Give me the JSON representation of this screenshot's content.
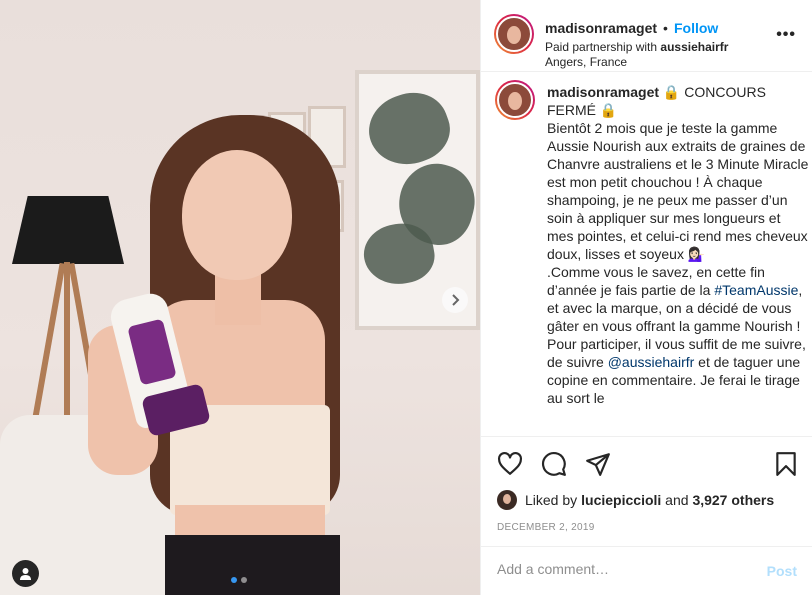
{
  "post": {
    "username": "madisonramaget",
    "dot": "•",
    "follow_label": "Follow",
    "partner_prefix": "Paid partnership with ",
    "partner": "aussiehairfr",
    "location": "Angers, France",
    "more_label": "•••"
  },
  "caption": {
    "username": "madisonramaget",
    "text_1": " 🔒 CONCOURS FERMÉ 🔒\nBientôt 2 mois que je teste la gamme Aussie Nourish aux extraits de graines de Chanvre australiens et le 3 Minute Miracle est mon petit chouchou ! À chaque shampoing, je ne peux me passer d’un soin à appliquer sur mes longueurs et mes pointes, et celui-ci rend mes cheveux doux, lisses et soyeux 💁🏻‍♀️\n.Comme vous le savez, en cette fin d’année je fais partie de la ",
    "hashtag": "#TeamAussie",
    "text_2": ", et avec la marque, on a décidé de vous gâter en vous offrant la gamme Nourish ! Pour participer, il vous suffit de me suivre, de suivre ",
    "mention": "@aussiehairfr",
    "text_3": " et de taguer une copine en commentaire. Je ferai le tirage au sort le"
  },
  "engagement": {
    "liked_by_prefix": "Liked by ",
    "liker": "luciepiccioli",
    "and": " and ",
    "others": "3,927 others",
    "date": "DECEMBER 2, 2019"
  },
  "comment": {
    "placeholder": "Add a comment…",
    "post_label": "Post"
  },
  "carousel": {
    "slide_count": 2,
    "active_slide": 1
  },
  "colors": {
    "follow": "#0095f6",
    "link": "#00376b",
    "post_disabled": "#b2dffc",
    "active_dot": "#3797f0"
  },
  "icons": [
    "like-icon",
    "comment-icon",
    "share-icon",
    "save-icon",
    "user-tag-icon",
    "next-arrow-icon",
    "more-options-icon"
  ]
}
